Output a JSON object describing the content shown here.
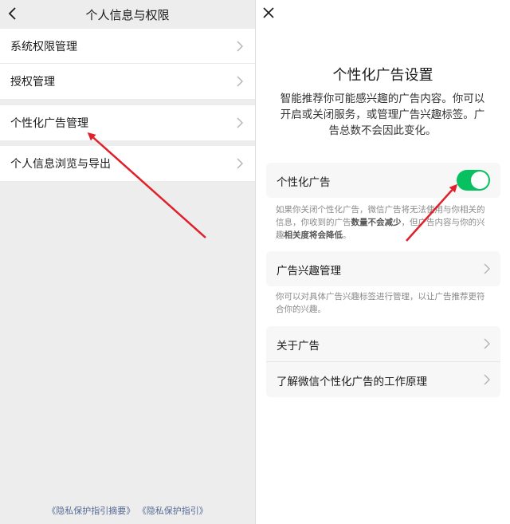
{
  "left": {
    "title": "个人信息与权限",
    "groups": [
      {
        "items": [
          {
            "label": "系统权限管理"
          },
          {
            "label": "授权管理"
          }
        ]
      },
      {
        "items": [
          {
            "label": "个性化广告管理"
          }
        ]
      },
      {
        "items": [
          {
            "label": "个人信息浏览与导出"
          }
        ]
      }
    ],
    "footer": {
      "link1": "《隐私保护指引摘要》",
      "link2": "《隐私保护指引》"
    }
  },
  "right": {
    "title": "个性化广告设置",
    "description": "智能推荐你可能感兴趣的广告内容。你可以开启或关闭服务，或管理广告兴趣标签。广告总数不会因此变化。",
    "personalized_ads": {
      "label": "个性化广告",
      "enabled": true
    },
    "note1": {
      "part1": "如果你关闭个性化广告，微信广告将无法使用与你相关的信息，你收到的广告",
      "bold1": "数量不会减少",
      "part2": "，但广告内容与你的兴趣",
      "bold2": "相关度将会降低",
      "part3": "。"
    },
    "interest_label": "广告兴趣管理",
    "note2": "你可以对具体广告兴趣标签进行管理，以让广告推荐更符合你的兴趣。",
    "about": [
      {
        "label": "关于广告"
      },
      {
        "label": "了解微信个性化广告的工作原理"
      }
    ]
  },
  "colors": {
    "accent": "#07c160",
    "link": "#576b95",
    "annotation_arrow": "#e0202a"
  }
}
